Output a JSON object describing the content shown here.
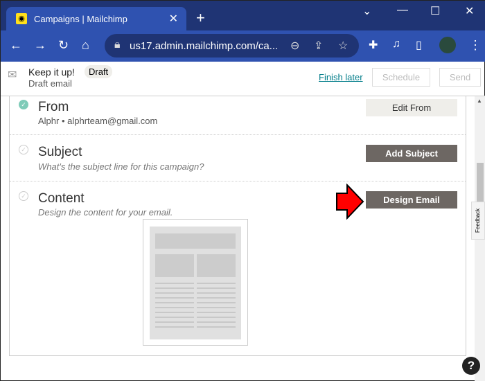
{
  "browser": {
    "tab_title": "Campaigns | Mailchimp",
    "url": "us17.admin.mailchimp.com/ca..."
  },
  "header": {
    "title": "Keep it up!",
    "badge": "Draft",
    "subtitle": "Draft email",
    "finish_later": "Finish later",
    "schedule": "Schedule",
    "send": "Send"
  },
  "rows": [
    {
      "title": "From",
      "subtitle": "Alphr • alphrteam@gmail.com",
      "button": "Edit From",
      "done": true
    },
    {
      "title": "Subject",
      "subtitle": "What's the subject line for this campaign?",
      "button": "Add Subject",
      "done": false
    },
    {
      "title": "Content",
      "subtitle": "Design the content for your email.",
      "button": "Design Email",
      "done": false
    }
  ],
  "feedback": "Feedback",
  "help": "?"
}
